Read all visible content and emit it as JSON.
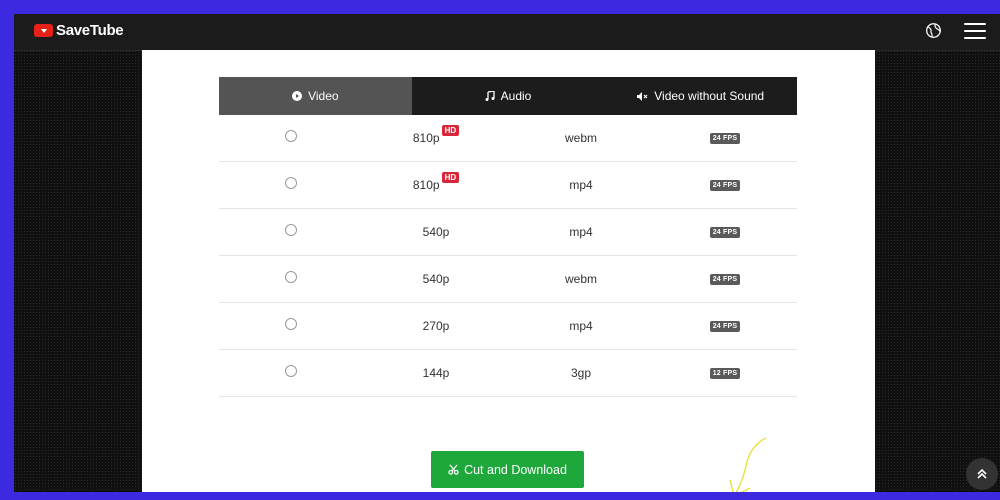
{
  "navbar": {
    "brand": "SaveTube",
    "globe_icon": "globe-icon",
    "menu_icon": "hamburger-menu-icon"
  },
  "tabs": [
    {
      "label": "Video",
      "icon": "play-circle-icon",
      "active": true
    },
    {
      "label": "Audio",
      "icon": "music-note-icon",
      "active": false
    },
    {
      "label": "Video without Sound",
      "icon": "volume-mute-icon",
      "active": false
    }
  ],
  "formats": [
    {
      "resolution": "810p",
      "hd_badge": "HD",
      "format": "webm",
      "fps": "24 FPS"
    },
    {
      "resolution": "810p",
      "hd_badge": "HD",
      "format": "mp4",
      "fps": "24 FPS"
    },
    {
      "resolution": "540p",
      "hd_badge": "",
      "format": "mp4",
      "fps": "24 FPS"
    },
    {
      "resolution": "540p",
      "hd_badge": "",
      "format": "webm",
      "fps": "24 FPS"
    },
    {
      "resolution": "270p",
      "hd_badge": "",
      "format": "mp4",
      "fps": "24 FPS"
    },
    {
      "resolution": "144p",
      "hd_badge": "",
      "format": "3gp",
      "fps": "12 FPS"
    }
  ],
  "download_button": {
    "label": "Cut and Download",
    "icon": "scissors-icon",
    "color": "#1ea83b"
  },
  "colors": {
    "frame": "#3b2ae0",
    "hd_badge": "#d9263a",
    "active_tab": "#545454"
  }
}
